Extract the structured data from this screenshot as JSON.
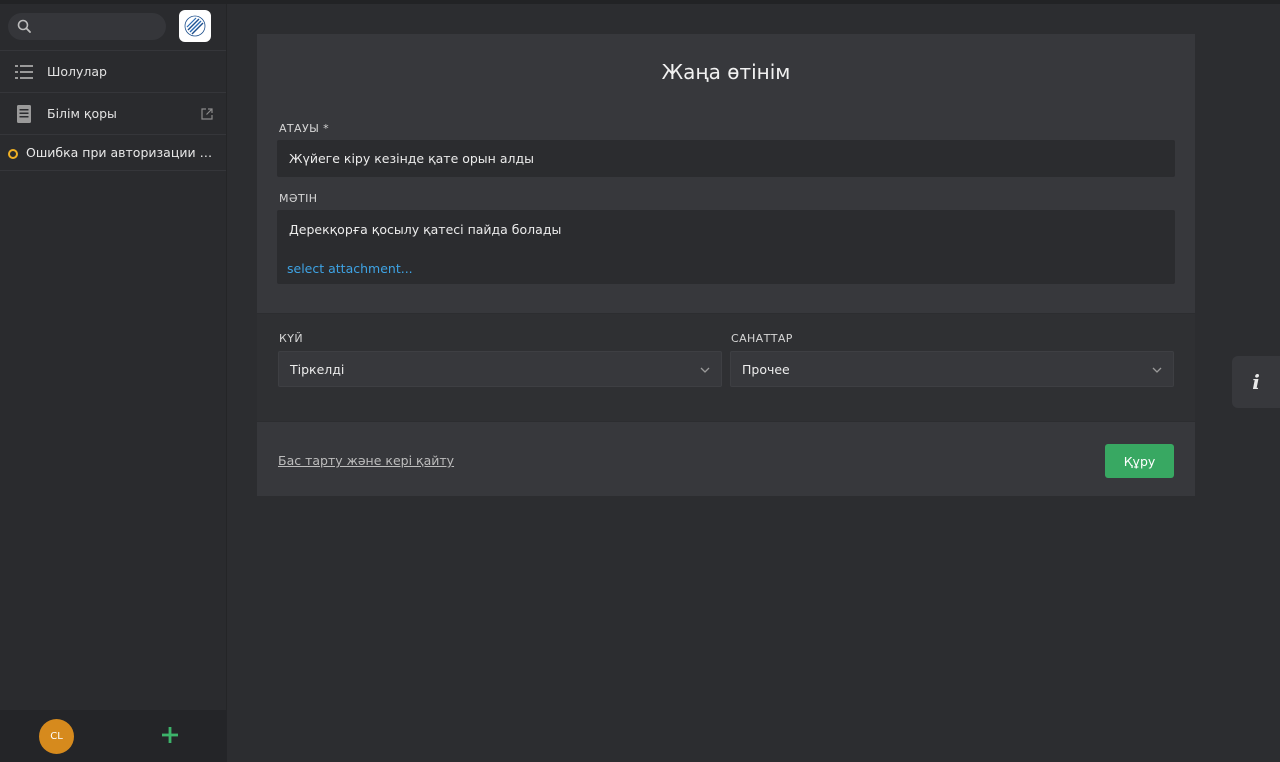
{
  "sidebar": {
    "search": {
      "placeholder": "",
      "value": ""
    },
    "logo_icon": "company-logo",
    "items": [
      {
        "label": "Шолулар",
        "icon": "list-icon"
      },
      {
        "label": "Білім қоры",
        "icon": "book-icon",
        "external": true
      }
    ],
    "tickets": [
      {
        "title": "Ошибка при авторизации в си...",
        "status_color": "#f0b024"
      }
    ],
    "footer": {
      "avatar_initials": "CL",
      "avatar_color": "#d68a1d"
    }
  },
  "form": {
    "title": "Жаңа өтінім",
    "title_label": "АТАУЫ *",
    "title_value": "Жүйеге кіру кезінде қате орын алды",
    "body_label": "МӘТІН",
    "body_value": "Дерекқорға қосылу қатесі пайда болады",
    "attachment_link": "select attachment...",
    "state_label": "КҮЙ",
    "state_value": "Тіркелді",
    "category_label": "САНАТТАР",
    "category_value": "Прочее",
    "cancel_label": "Бас тарту және кері қайту",
    "create_label": "Құру"
  },
  "colors": {
    "accent_green": "#38a862",
    "link_blue": "#3ea3e4",
    "status_pending": "#f0b024"
  }
}
